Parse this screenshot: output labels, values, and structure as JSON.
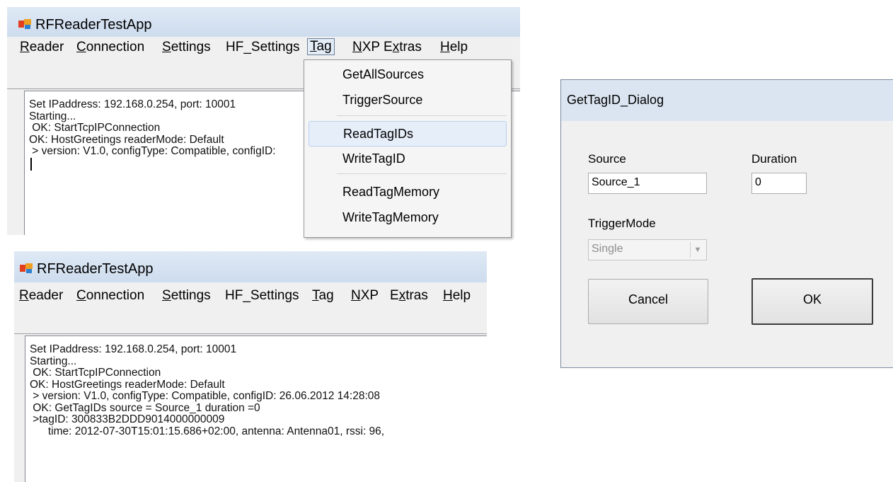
{
  "app": {
    "title": "RFReaderTestApp"
  },
  "menu": [
    {
      "label": "Reader",
      "u": "R",
      "rest": "eader"
    },
    {
      "label": "Connection",
      "u": "C",
      "rest": "onnection"
    },
    {
      "label": "Settings",
      "u": "S",
      "rest": "ettings"
    },
    {
      "label": "HF_Settings",
      "u": "",
      "rest": "HF_Settings"
    },
    {
      "label": "Tag",
      "u": "T",
      "rest": "ag"
    },
    {
      "label": "NXP",
      "u": "N",
      "rest": "XP"
    },
    {
      "label": "Extras",
      "u": "x",
      "pre": "E",
      "rest": "tras"
    },
    {
      "label": "Help",
      "u": "H",
      "rest": "elp"
    }
  ],
  "tag_menu": {
    "items": [
      "GetAllSources",
      "TriggerSource",
      "ReadTagIDs",
      "WriteTagID",
      "ReadTagMemory",
      "WriteTagMemory"
    ],
    "highlighted": "ReadTagIDs"
  },
  "log_top": [
    "Set IPaddress: 192.168.0.254, port: 10001",
    "Starting...",
    " OK: StartTcpIPConnection",
    "OK: HostGreetings readerMode: Default",
    " > version: V1.0, configType: Compatible, configID:"
  ],
  "log_bottom": [
    "Set IPaddress: 192.168.0.254, port: 10001",
    "Starting...",
    " OK: StartTcpIPConnection",
    "OK: HostGreetings readerMode: Default",
    " > version: V1.0, configType: Compatible, configID: 26.06.2012 14:28:08",
    " OK: GetTagIDs source = Source_1 duration =0",
    " >tagID: 300833B2DDD9014000000009",
    "      time: 2012-07-30T15:01:15.686+02:00, antenna: Antenna01, rssi: 96,"
  ],
  "dialog": {
    "title": "GetTagID_Dialog",
    "source_label": "Source",
    "source_value": "Source_1",
    "duration_label": "Duration",
    "duration_value": "0",
    "trigger_label": "TriggerMode",
    "trigger_value": "Single",
    "cancel": "Cancel",
    "ok": "OK"
  }
}
